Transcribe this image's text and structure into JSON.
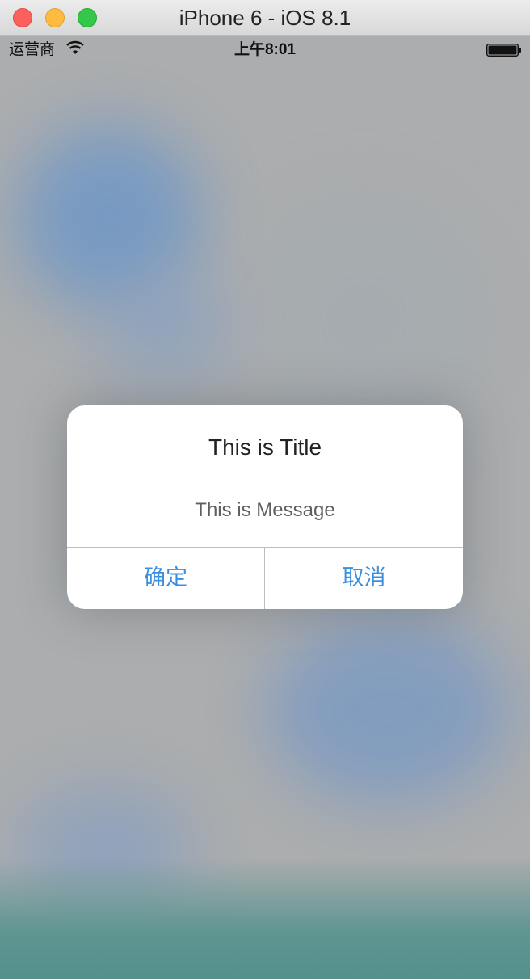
{
  "window": {
    "title": "iPhone 6 - iOS 8.1"
  },
  "status_bar": {
    "carrier": "运营商",
    "time": "上午8:01",
    "icons": [
      "wifi-icon",
      "battery-icon"
    ]
  },
  "alert": {
    "title": "This is Title",
    "message": "This is Message",
    "buttons": [
      {
        "label": "确定"
      },
      {
        "label": "取消"
      }
    ]
  },
  "colors": {
    "button_text": "#3a8fe0",
    "close": "#fc605c",
    "minimize": "#fdbc40",
    "zoom": "#34c84a"
  }
}
